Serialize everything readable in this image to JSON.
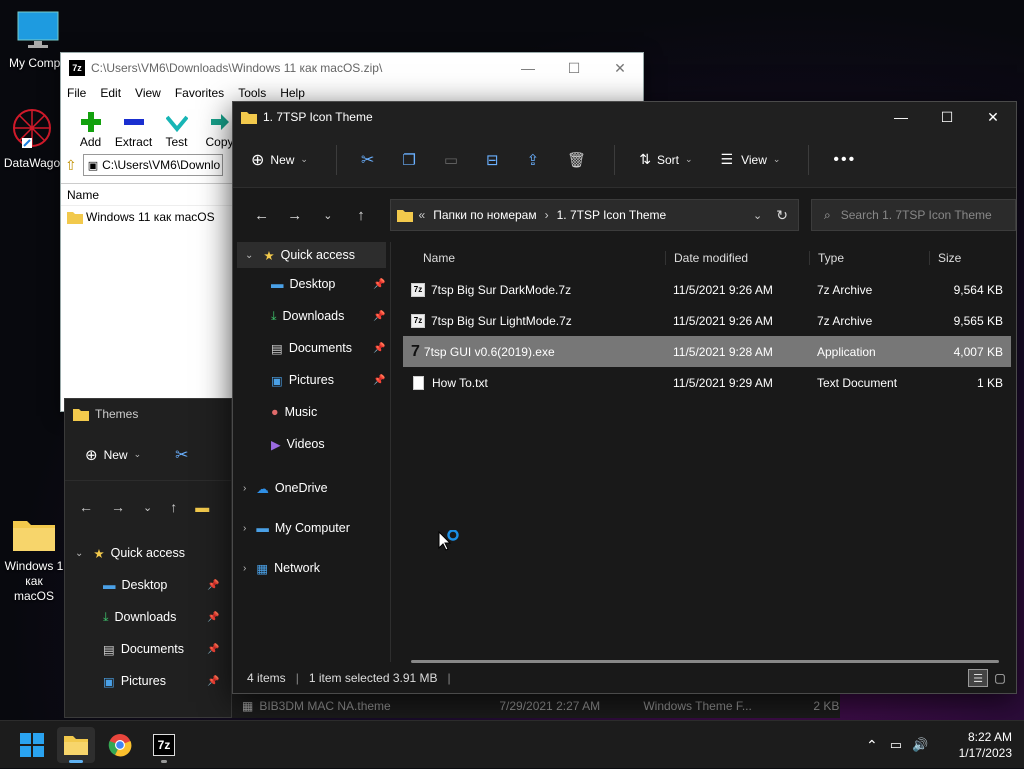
{
  "desktop": {
    "icons": [
      {
        "label": "My Compu"
      },
      {
        "label": "DataWago"
      },
      {
        "label": "Windows 1\nкак macOS"
      }
    ]
  },
  "zip_window": {
    "title": "C:\\Users\\VM6\\Downloads\\Windows 11 как macOS.zip\\",
    "menu": [
      "File",
      "Edit",
      "View",
      "Favorites",
      "Tools",
      "Help"
    ],
    "tools": [
      {
        "label": "Add",
        "icon": "plus-icon"
      },
      {
        "label": "Extract",
        "icon": "minus-icon"
      },
      {
        "label": "Test",
        "icon": "check-icon"
      },
      {
        "label": "Copy",
        "icon": "arrow-right-icon"
      }
    ],
    "address": "C:\\Users\\VM6\\Downlo",
    "column_name": "Name",
    "rows": [
      "Windows 11 как macOS"
    ]
  },
  "themes_window": {
    "title": "Themes",
    "new_label": "New",
    "nav_items": [
      {
        "label": "Quick access"
      },
      {
        "label": "Desktop"
      },
      {
        "label": "Downloads"
      },
      {
        "label": "Documents"
      },
      {
        "label": "Pictures"
      }
    ]
  },
  "explorer": {
    "title": "1. 7TSP Icon Theme",
    "toolbar": {
      "new": "New",
      "sort": "Sort",
      "view": "View"
    },
    "path": {
      "prefix": "«",
      "parent": "Папки по номерам",
      "sep": "›",
      "current": "1. 7TSP Icon Theme"
    },
    "search_placeholder": "Search 1. 7TSP Icon Theme",
    "sidebar": {
      "quick_access": "Quick access",
      "pinned": [
        {
          "label": "Desktop"
        },
        {
          "label": "Downloads"
        },
        {
          "label": "Documents"
        },
        {
          "label": "Pictures"
        },
        {
          "label": "Music"
        },
        {
          "label": "Videos"
        }
      ],
      "roots": [
        {
          "label": "OneDrive"
        },
        {
          "label": "My Computer"
        },
        {
          "label": "Network"
        }
      ]
    },
    "columns": [
      "Name",
      "Date modified",
      "Type",
      "Size"
    ],
    "files": [
      {
        "name": "7tsp Big Sur DarkMode.7z",
        "date": "11/5/2021 9:26 AM",
        "type": "7z Archive",
        "size": "9,564 KB"
      },
      {
        "name": "7tsp Big Sur LightMode.7z",
        "date": "11/5/2021 9:26 AM",
        "type": "7z Archive",
        "size": "9,565 KB"
      },
      {
        "name": "7tsp GUI v0.6(2019).exe",
        "date": "11/5/2021 9:28 AM",
        "type": "Application",
        "size": "4,007 KB"
      },
      {
        "name": "How To.txt",
        "date": "11/5/2021 9:29 AM",
        "type": "Text Document",
        "size": "1 KB"
      }
    ],
    "status": {
      "items": "4 items",
      "selected": "1 item selected  3.91 MB"
    }
  },
  "behind_row": {
    "name": "BIB3DM MAC NA.theme",
    "date": "7/29/2021 2:27 AM",
    "type": "Windows Theme F...",
    "size": "2 KB"
  },
  "taskbar": {
    "time": "8:22 AM",
    "date": "1/17/2023"
  },
  "colors": {
    "accent": "#0067c0",
    "folder": "#f2c94c",
    "selection": "#777777"
  }
}
